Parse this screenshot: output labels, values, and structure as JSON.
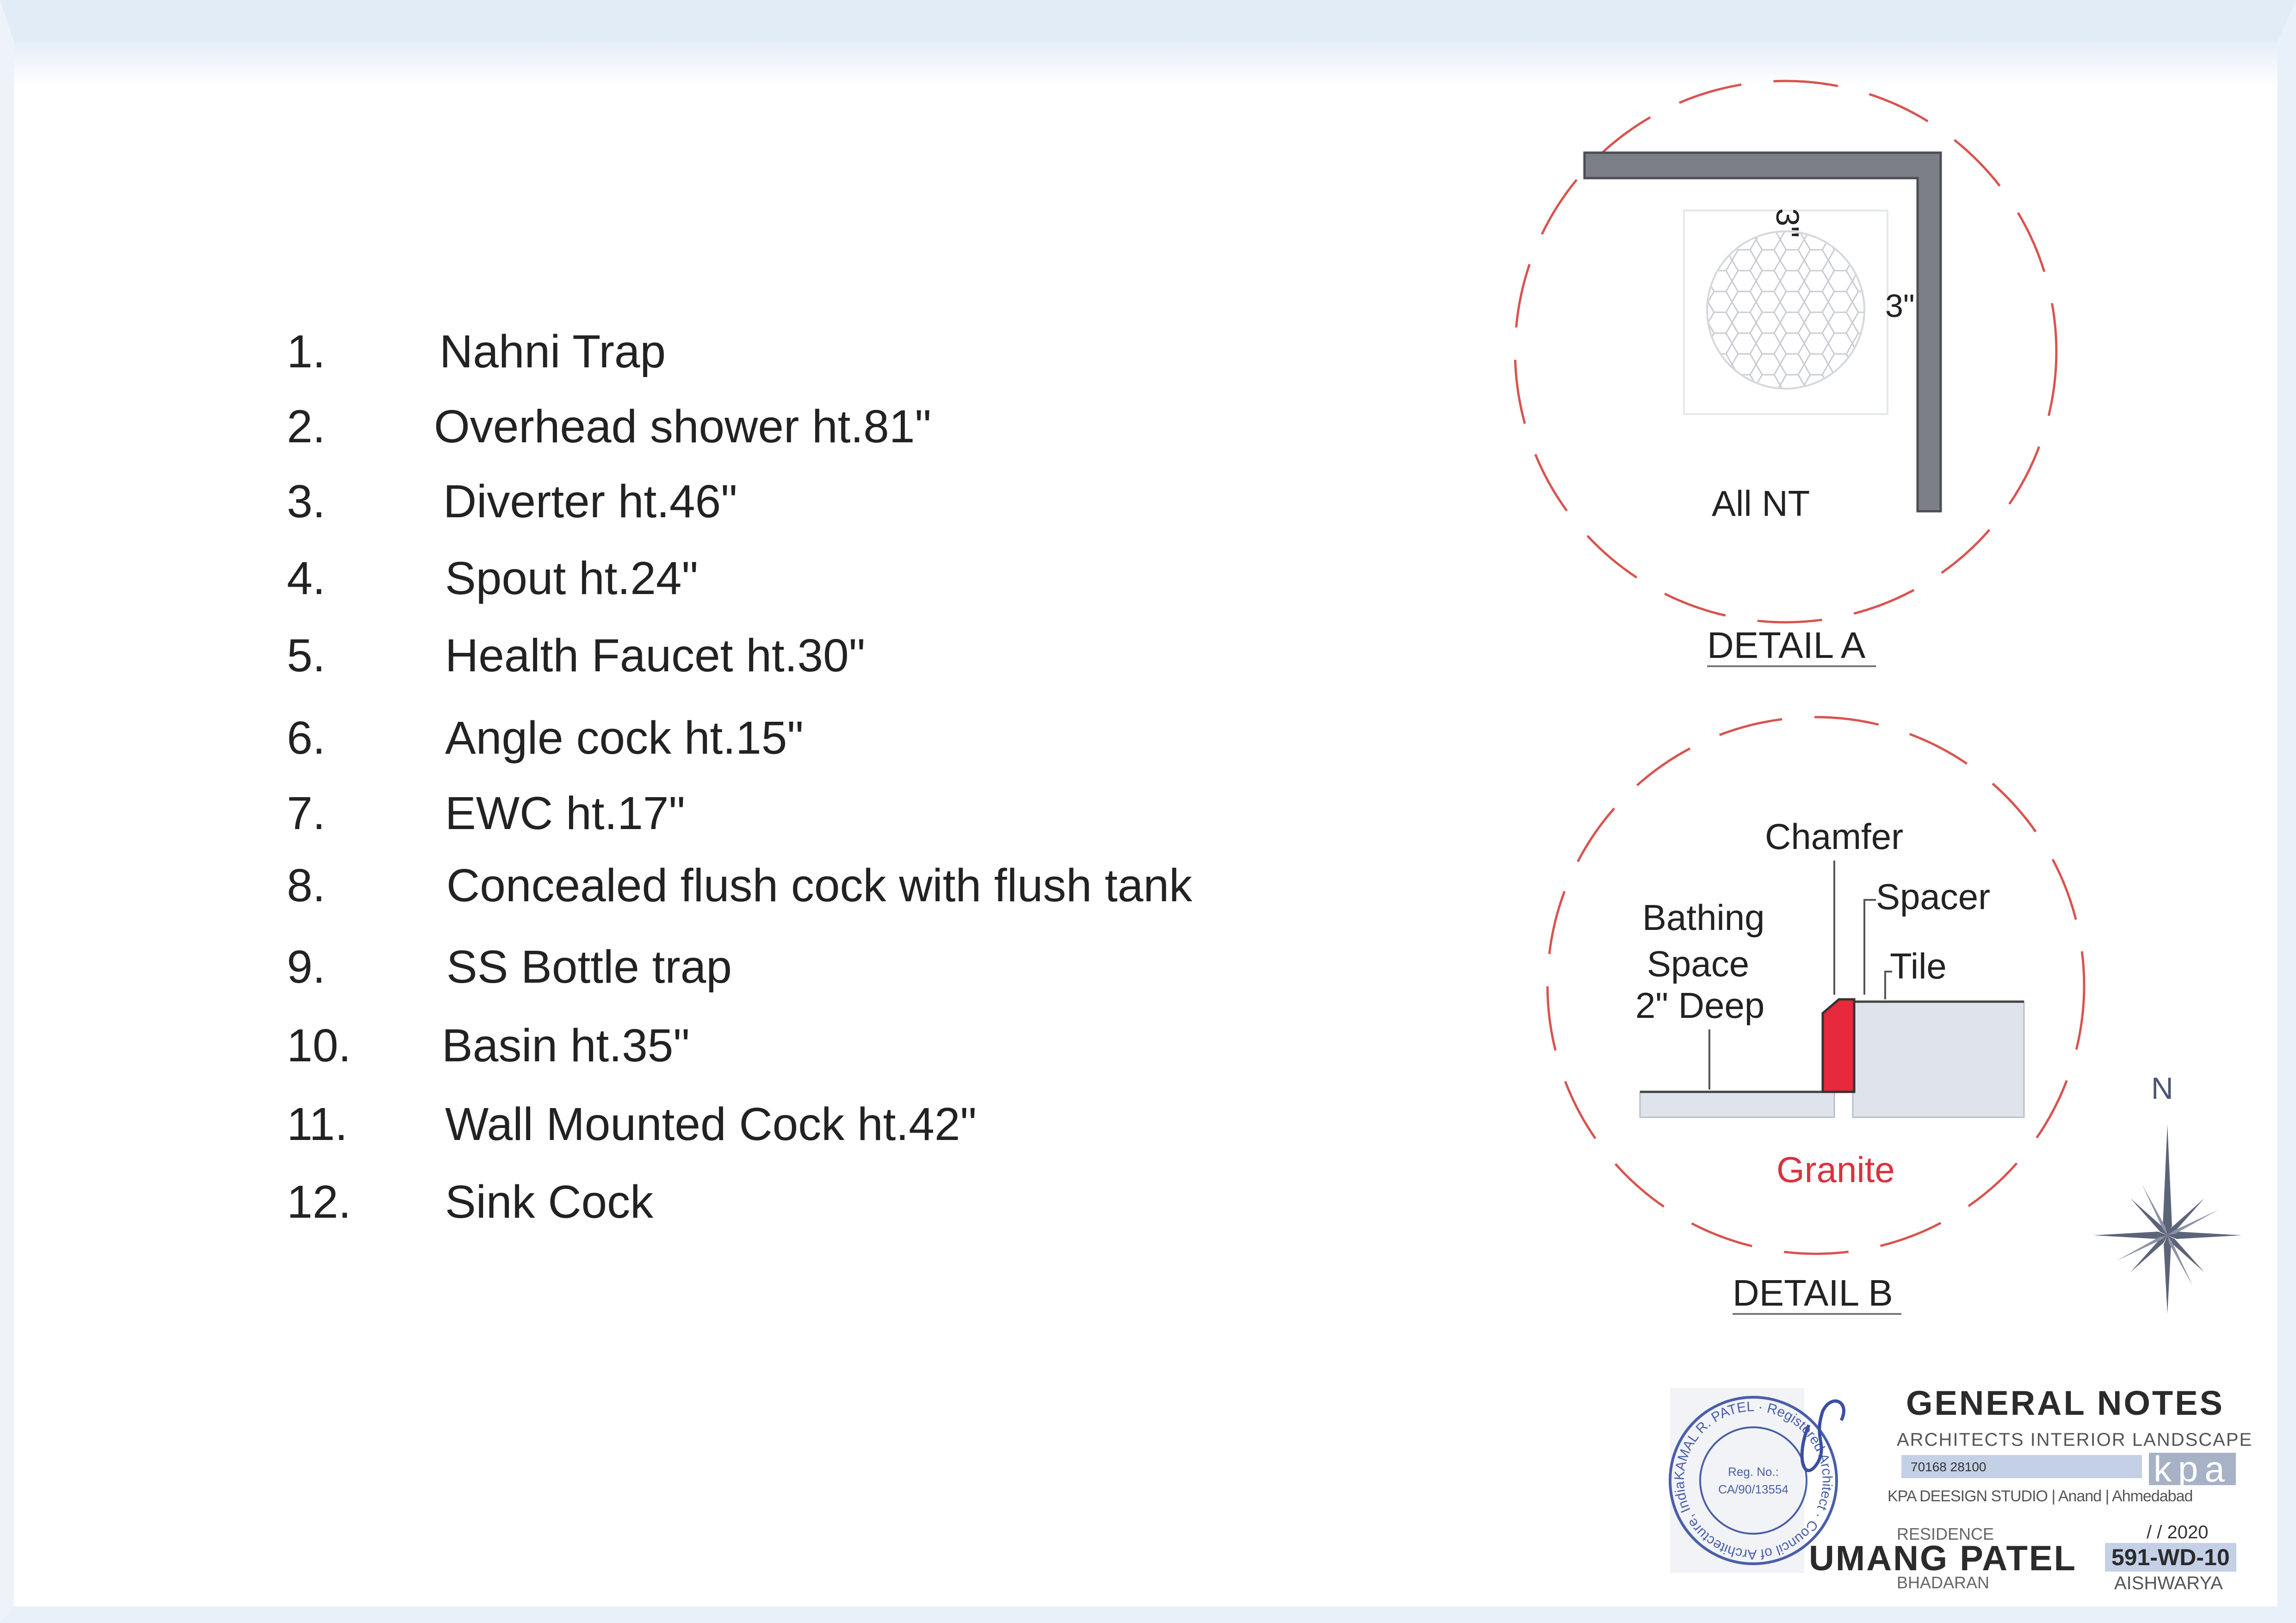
{
  "notes": [
    {
      "num": "1.",
      "text": "Nahni Trap"
    },
    {
      "num": "2.",
      "text": "Overhead shower ht.81\""
    },
    {
      "num": "3.",
      "text": "Diverter ht.46\""
    },
    {
      "num": "4.",
      "text": "Spout ht.24\""
    },
    {
      "num": "5.",
      "text": "Health Faucet ht.30\""
    },
    {
      "num": "6.",
      "text": "Angle cock ht.15\""
    },
    {
      "num": "7.",
      "text": "EWC ht.17\""
    },
    {
      "num": "8.",
      "text": "Concealed flush cock with  flush tank"
    },
    {
      "num": "9.",
      "text": "SS Bottle trap"
    },
    {
      "num": "10.",
      "text": "Basin ht.35\""
    },
    {
      "num": "11.",
      "text": "Wall Mounted Cock ht.42\""
    },
    {
      "num": "12.",
      "text": "Sink Cock"
    }
  ],
  "detail_a": {
    "title": "DETAIL A",
    "dim_top": "3\"",
    "dim_right": "3\"",
    "note": "All  NT"
  },
  "detail_b": {
    "title": "DETAIL B",
    "chamfer": "Chamfer",
    "spacer": "Spacer",
    "tile": "Tile",
    "bathing_line1": "Bathing",
    "bathing_line2": "Space",
    "bathing_line3": "2\" Deep",
    "material": "Granite"
  },
  "north": {
    "label": "N"
  },
  "stamp": {
    "outer_text": "KAMAL R. PATEL · Registered Architect · Council of Architecture, India",
    "reg_label": "Reg. No.:",
    "reg_no": "CA/90/13554"
  },
  "title_block": {
    "heading": "GENERAL NOTES",
    "firm": "ARCHITECTS  INTERIOR  LANDSCAPE",
    "phone": "70168 28100",
    "logo": "kpa",
    "studio": "KPA DEESIGN STUDIO | Anand | Ahmedabad",
    "project_type": "RESIDENCE",
    "date": "/   / 2020",
    "client": "UMANG PATEL",
    "sheet_no": "591-WD-10",
    "location": "BHADARAN",
    "drawn_by": "AISHWARYA"
  },
  "colors": {
    "dash_circle": "#d9534f",
    "wall_gray": "#7d7f86",
    "chamfer_red": "#e8283c",
    "granite_red": "#d9323f",
    "step_fill": "#dfe4ec",
    "stamp_blue": "#4a5fa8"
  }
}
